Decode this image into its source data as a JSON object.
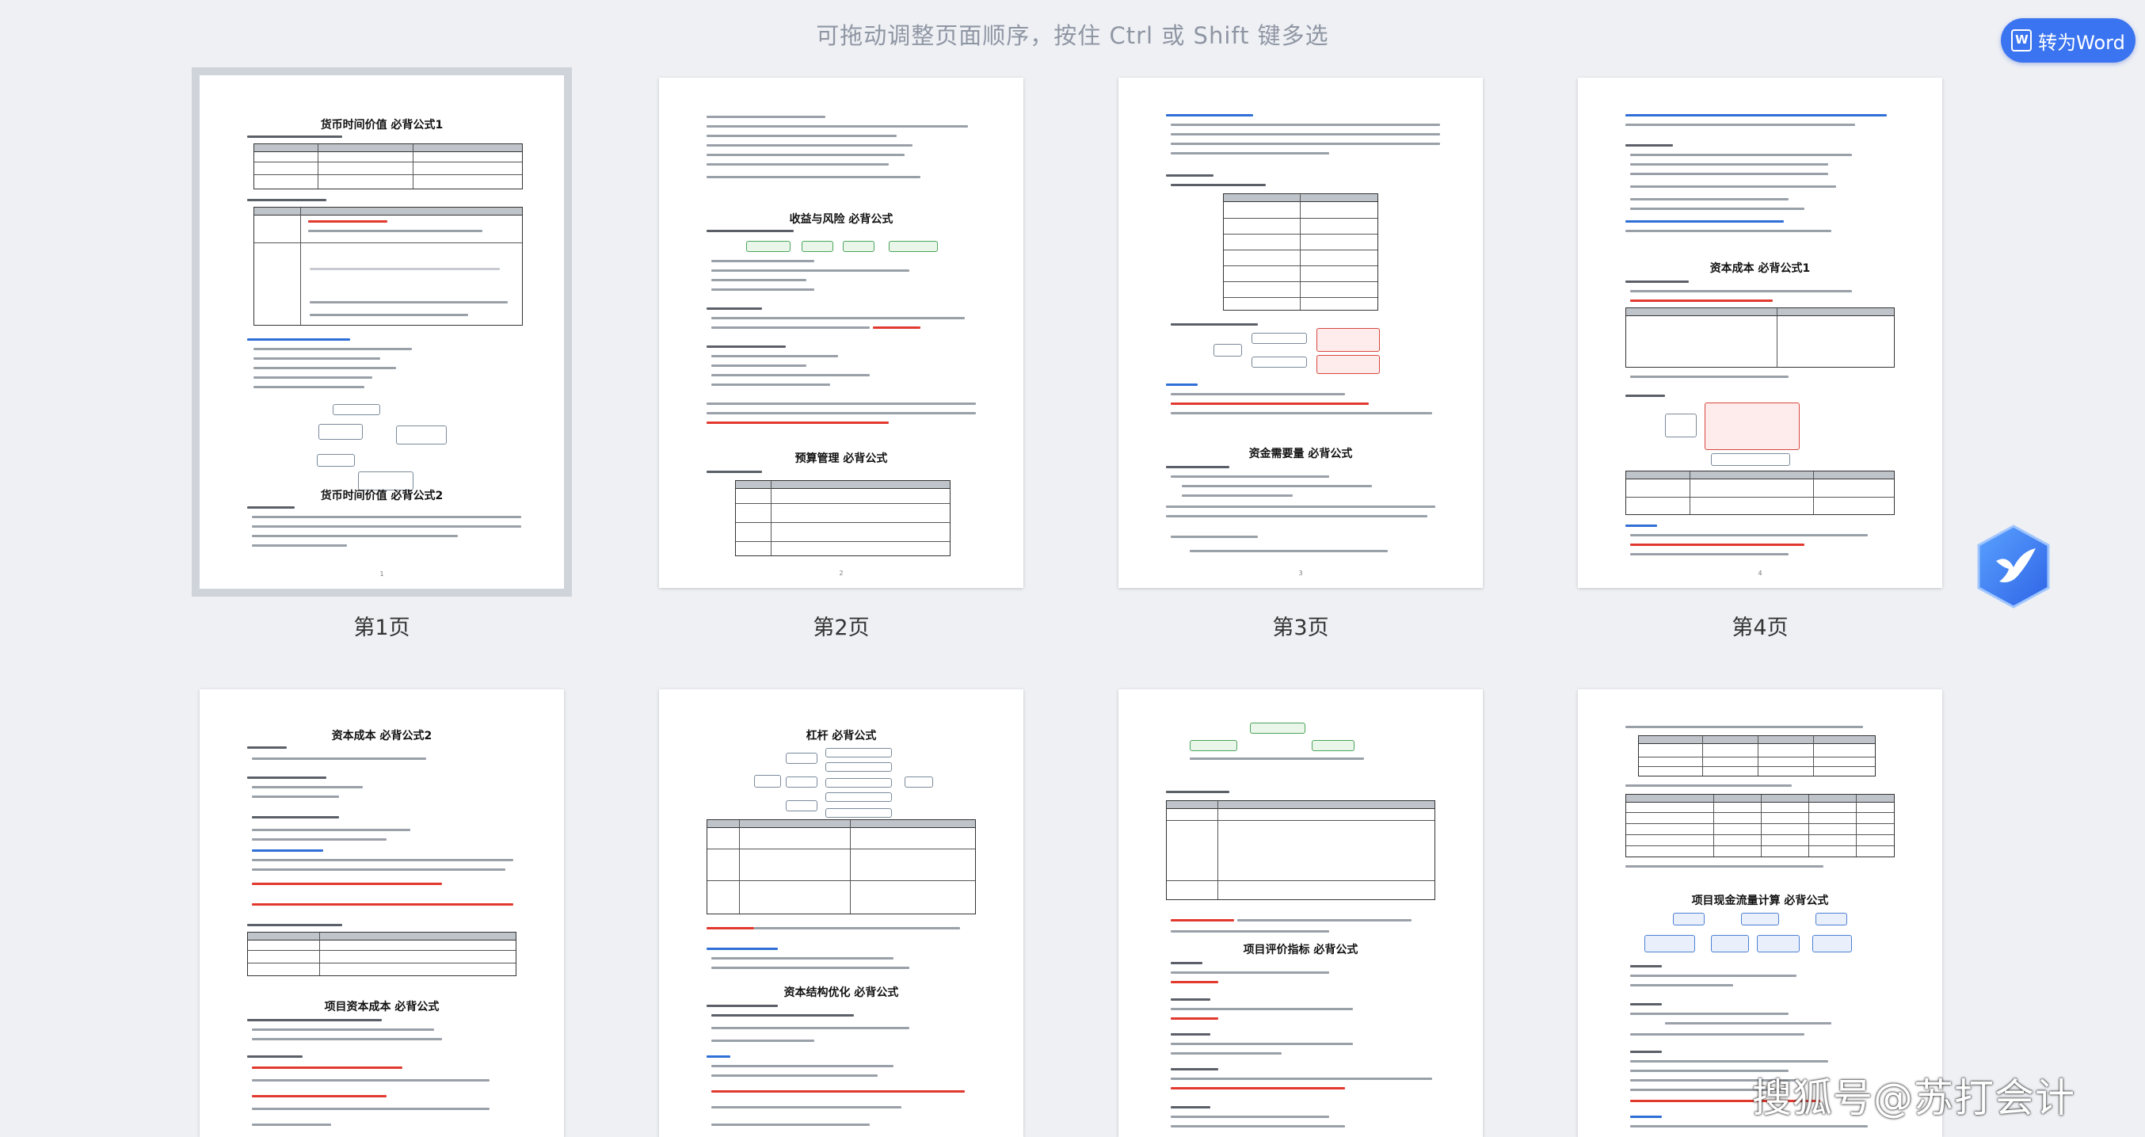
{
  "header": {
    "hint": "可拖动调整页面顺序，按住 Ctrl 或 Shift 键多选",
    "convert_button": "转为Word"
  },
  "pages": [
    {
      "label": "第1页",
      "titles": [
        "货币时间价值  必背公式1",
        "货币时间价值  必背公式2"
      ],
      "number": "1"
    },
    {
      "label": "第2页",
      "titles": [
        "收益与风险  必背公式",
        "预算管理  必背公式"
      ],
      "number": "2"
    },
    {
      "label": "第3页",
      "titles": [
        "资金需要量  必背公式"
      ],
      "number": "3"
    },
    {
      "label": "第4页",
      "titles": [
        "资本成本  必背公式1"
      ],
      "number": "4"
    },
    {
      "label": "",
      "titles": [
        "资本成本  必背公式2",
        "项目资本成本  必背公式"
      ],
      "number": ""
    },
    {
      "label": "",
      "titles": [
        "杠杆  必背公式",
        "资本结构优化  必背公式"
      ],
      "number": ""
    },
    {
      "label": "",
      "titles": [
        "项目评价指标  必背公式"
      ],
      "number": ""
    },
    {
      "label": "",
      "titles": [
        "项目现金流量计算  必背公式"
      ],
      "number": ""
    }
  ],
  "watermark": "搜狐号@苏打会计",
  "colors": {
    "accent": "#3b74f0",
    "background": "#eef0f4"
  }
}
